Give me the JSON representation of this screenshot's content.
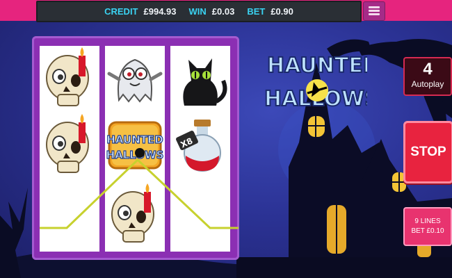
{
  "hud": {
    "credit_label": "CREDIT",
    "credit_value": "£994.93",
    "win_label": "WIN",
    "win_value": "£0.03",
    "bet_label": "BET",
    "bet_value": "£0.90"
  },
  "menu": {
    "icon": "hamburger-icon"
  },
  "logo": {
    "line1": "HAUNTED",
    "line2": "HALLOWS"
  },
  "controls": {
    "autoplay_count": "4",
    "autoplay_label": "Autoplay",
    "stop_label": "STOP",
    "lines_label": "9 LINES",
    "bet_line_label": "BET £0.10"
  },
  "reels": [
    [
      "skull-candle",
      "skull-candle",
      "blank"
    ],
    [
      "ghost",
      "haunted-hallows-logo",
      "skull-candle"
    ],
    [
      "black-cat",
      "x8-potion",
      "blank"
    ]
  ],
  "potion_multiplier": "X8",
  "win_line": {
    "color": "#c7d12e"
  }
}
